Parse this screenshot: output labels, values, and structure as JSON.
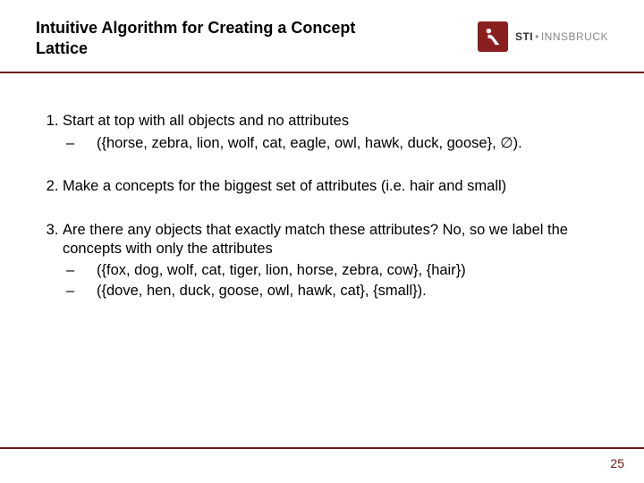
{
  "header": {
    "title": "Intuitive Algorithm for Creating a Concept Lattice",
    "logo": {
      "sti": "STI",
      "inn": "INNSBRUCK"
    }
  },
  "items": [
    {
      "text": "Start at top with all objects and no attributes",
      "sub": [
        "({horse, zebra, lion, wolf, cat, eagle, owl, hawk, duck, goose}, ∅)."
      ]
    },
    {
      "text": "Make a concepts for the biggest set of attributes (i.e. hair and small)",
      "sub": []
    },
    {
      "text": "Are there any objects that exactly match these attributes? No, so we label the concepts with only the attributes",
      "sub": [
        "({fox, dog, wolf, cat, tiger, lion, horse, zebra, cow}, {hair})",
        "({dove, hen, duck, goose, owl, hawk, cat}, {small})."
      ]
    }
  ],
  "page_number": "25"
}
